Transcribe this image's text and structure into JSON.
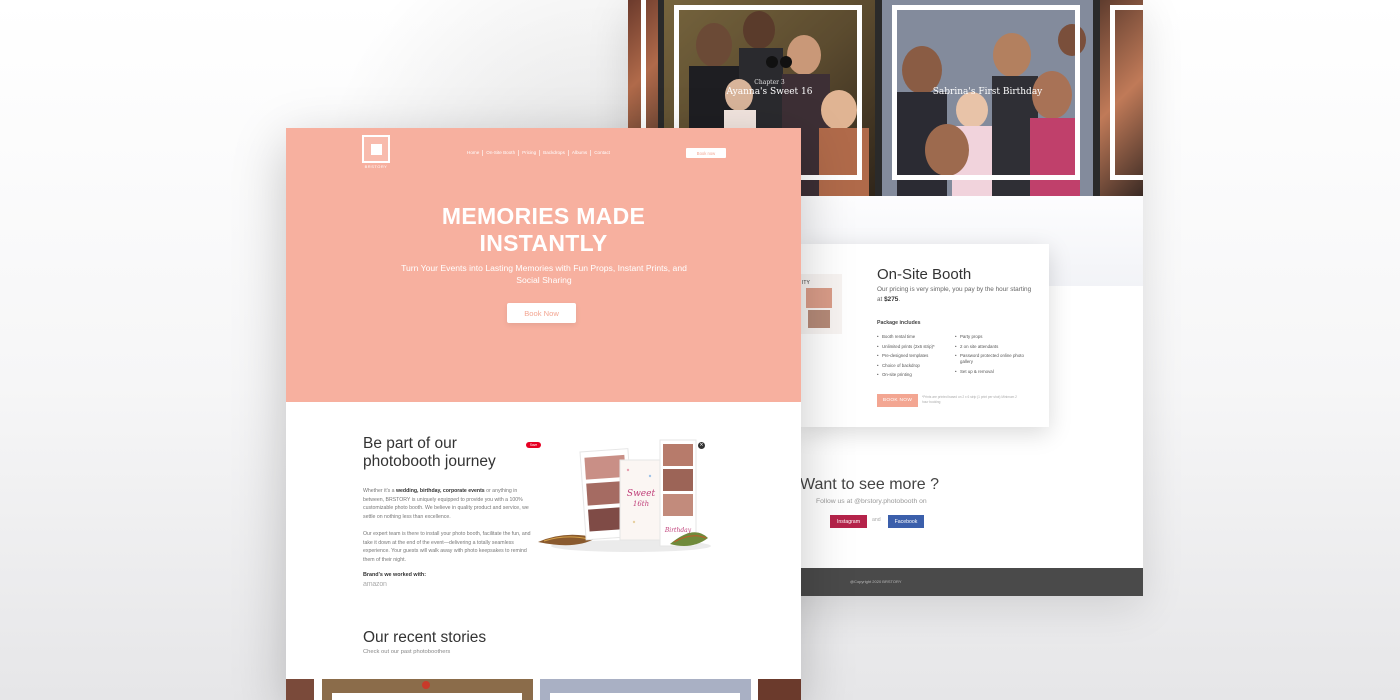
{
  "colors": {
    "brand_salmon": "#f7b09f",
    "button_salmon": "#f3a692",
    "instagram": "#b5234a",
    "facebook": "#3b5fab",
    "pinterest": "#e60023",
    "footer": "#4a4a4a"
  },
  "front": {
    "logo": {
      "icon": "square-logo-icon",
      "text": "BRSTORY"
    },
    "nav": {
      "items": [
        "Home",
        "On-Site Booth",
        "Pricing",
        "Backdrops",
        "Albums",
        "Contact"
      ],
      "book_label": "Book now"
    },
    "hero": {
      "title_line1": "MEMORIES MADE",
      "title_line2": "INSTANTLY",
      "subtitle": "Turn Your Events into Lasting Memories with Fun Props, Instant Prints, and Social Sharing",
      "button": "Book Now"
    },
    "journey": {
      "title_line1": "Be part of our",
      "title_line2": "photobooth journey",
      "p1_lead": "Whether it's a ",
      "p1_bold": "wedding, birthday, corporate events",
      "p1_rest": " or anything in between, BRSTORY is uniquely equipped to provide you with a 100% customizable photo booth. We believe in quality product and service, we settle on nothing less than excellence.",
      "p2": "Our expert team is there to install your photo booth, facilitate the fun, and take it down at the end of the event—delivering a totally seamless experience. Your guests will walk away with photo keepsakes to remind them of their night.",
      "brands_label": "Brand's we worked with:",
      "brand": "amazon",
      "pin_label": "Save",
      "close_icon": "close-icon"
    },
    "stories": {
      "title": "Our recent stories",
      "subtitle": "Check out our past photoboothers"
    }
  },
  "back": {
    "stories": [
      {
        "chapter": "Chapter 3",
        "title": "Ayanna's Sweet 16"
      },
      {
        "chapter": "",
        "title": "Sabrina's First Birthday"
      }
    ],
    "pricing": {
      "title": "On-Site Booth",
      "desc_lead": "Our pricing is very simple, you pay by the hour starting at ",
      "desc_price": "$275",
      "desc_end": ".",
      "package_title": "Package includes",
      "col1": [
        "Booth rental time",
        "Unlimited prints (2x6 strip)*",
        "Pre-designed templates",
        "Choice of backdrop",
        "On-site printing"
      ],
      "col2": [
        "Party props",
        "2 on site attendants",
        "Password protected online photo gallery",
        "Set up & removal"
      ],
      "button": "BOOK NOW",
      "fine_print": "*Prints are printed based on 2 x 6 strip (1 print per shot) Minimum 2 hour booking"
    },
    "more": {
      "title": "Want to see more ?",
      "subtitle": "Follow us at @brstory.photobooth on",
      "instagram": "Instagram",
      "and": "and",
      "facebook": "Facebook"
    },
    "footer": "@Copyright 2020 BRSTORY"
  }
}
